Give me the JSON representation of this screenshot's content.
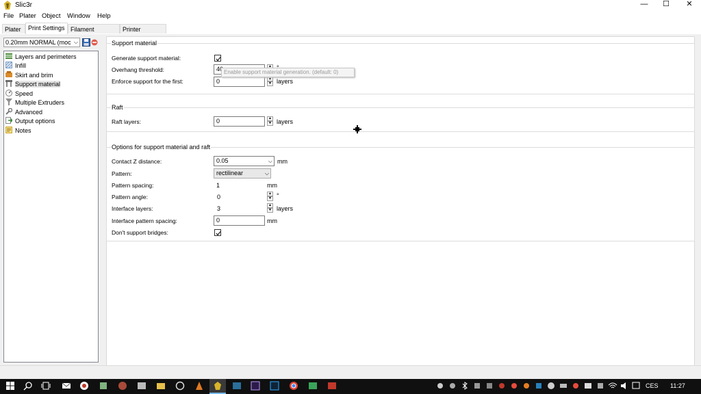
{
  "window": {
    "title": "Slic3r",
    "minimize": "—",
    "maximize": "☐",
    "close": "✕"
  },
  "menu": [
    "File",
    "Plater",
    "Object",
    "Window",
    "Help"
  ],
  "tabs": [
    "Plater",
    "Print Settings",
    "Filament Settings",
    "Printer Settings"
  ],
  "preset": {
    "selected": "0.20mm NORMAL (moc"
  },
  "categories": [
    {
      "label": "Layers and perimeters",
      "icon": "layers-icon",
      "color": "#4a8a3a"
    },
    {
      "label": "Infill",
      "icon": "infill-icon",
      "color": "#7a9cc6"
    },
    {
      "label": "Skirt and brim",
      "icon": "skirt-icon",
      "color": "#d98b2b"
    },
    {
      "label": "Support material",
      "icon": "support-icon",
      "color": "#6d6d6d"
    },
    {
      "label": "Speed",
      "icon": "speed-icon",
      "color": "#808080"
    },
    {
      "label": "Multiple Extruders",
      "icon": "funnel-icon",
      "color": "#909090"
    },
    {
      "label": "Advanced",
      "icon": "wrench-icon",
      "color": "#7b7b7b"
    },
    {
      "label": "Output options",
      "icon": "output-icon",
      "color": "#3c8a3c"
    },
    {
      "label": "Notes",
      "icon": "notes-icon",
      "color": "#e8c34a"
    }
  ],
  "support": {
    "group_title": "Support material",
    "generate_label": "Generate support material:",
    "generate_checked": true,
    "overhang_label": "Overhang threshold:",
    "overhang_value": "40",
    "overhang_unit": "°",
    "enforce_label": "Enforce support for the first:",
    "enforce_value": "0",
    "enforce_unit": "layers",
    "tooltip": "Enable support material generation. (default: 0)"
  },
  "raft": {
    "group_title": "Raft",
    "layers_label": "Raft layers:",
    "layers_value": "0",
    "layers_unit": "layers"
  },
  "options": {
    "group_title": "Options for support material and raft",
    "contact_label": "Contact Z distance:",
    "contact_value": "0.05",
    "contact_unit": "mm",
    "pattern_label": "Pattern:",
    "pattern_value": "rectilinear",
    "spacing_label": "Pattern spacing:",
    "spacing_value": "1",
    "spacing_unit": "mm",
    "angle_label": "Pattern angle:",
    "angle_value": "0",
    "angle_unit": "°",
    "interface_label": "Interface layers:",
    "interface_value": "3",
    "interface_unit": "layers",
    "interface_spacing_label": "Interface pattern spacing:",
    "interface_spacing_value": "0",
    "interface_spacing_unit": "mm",
    "bridges_label": "Don't support bridges:",
    "bridges_checked": true
  },
  "taskbar": {
    "lang": "CES",
    "time": "11:27"
  }
}
